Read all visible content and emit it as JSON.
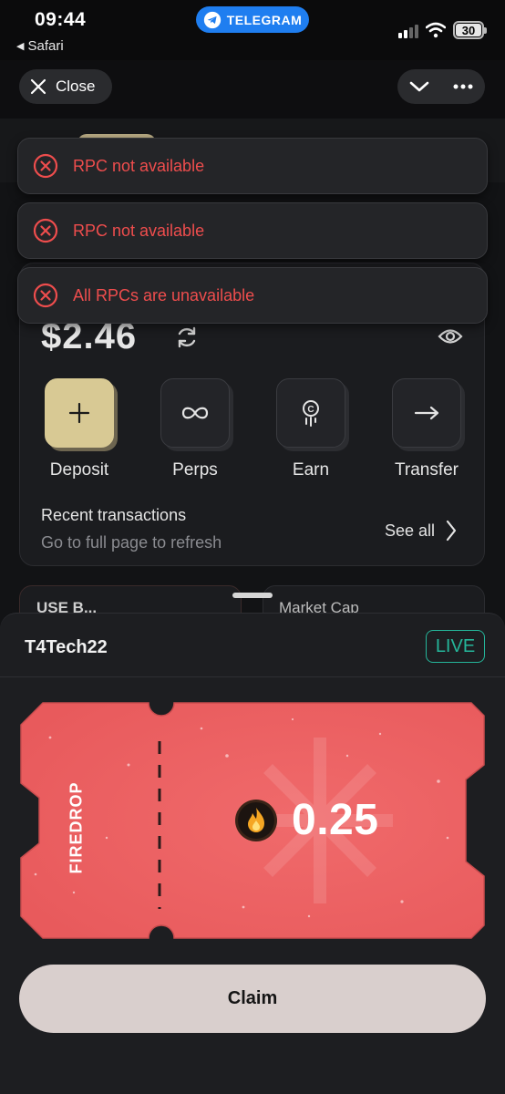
{
  "status_bar": {
    "time": "09:44",
    "back_app": "Safari",
    "telegram_pill": "TELEGRAM",
    "battery": "30"
  },
  "header": {
    "close_label": "Close"
  },
  "toasts": [
    {
      "message": "RPC not available"
    },
    {
      "message": "RPC not available"
    },
    {
      "message": "All RPCs are unavailable"
    }
  ],
  "wallet": {
    "balance": "$2.46",
    "actions": [
      {
        "label": "Deposit",
        "icon": "plus-icon"
      },
      {
        "label": "Perps",
        "icon": "infinity-icon"
      },
      {
        "label": "Earn",
        "icon": "coin-stack-icon"
      },
      {
        "label": "Transfer",
        "icon": "arrow-right-icon"
      }
    ],
    "recent_title": "Recent transactions",
    "recent_sub": "Go to full page to refresh",
    "see_all": "See all"
  },
  "peek_cards": {
    "left": "USE B...",
    "right": "Market Cap"
  },
  "sheet": {
    "title": "T4Tech22",
    "badge": "LIVE",
    "ticket_label": "FIREDROP",
    "ticket_value": "0.25",
    "claim_label": "Claim"
  },
  "colors": {
    "error": "#ee4d4d",
    "accent_gold": "#d8c994",
    "live_green": "#25b69a",
    "ticket_red": "#ee6163",
    "telegram_blue": "#1f7ef0"
  }
}
